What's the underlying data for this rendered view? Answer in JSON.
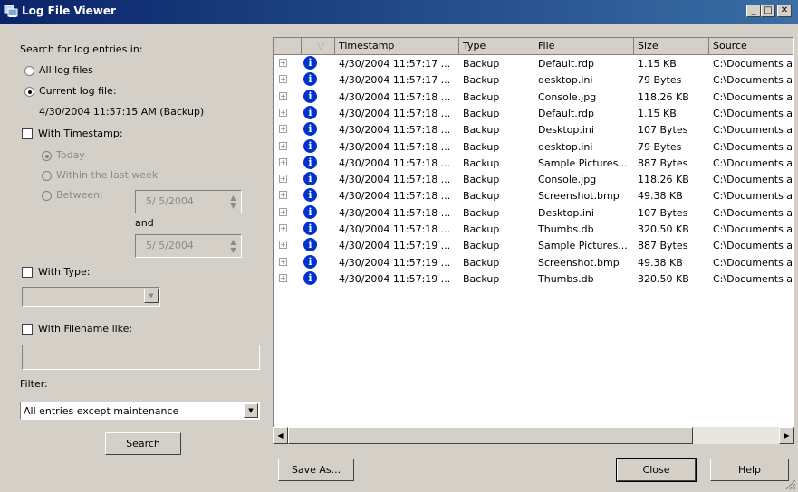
{
  "window": {
    "title": "Log File Viewer",
    "minimize_glyph": "_",
    "maximize_glyph": "□",
    "close_glyph": "✕"
  },
  "search": {
    "heading": "Search for log entries in:",
    "all_log_files": "All log files",
    "current_log_file": "Current log file:",
    "current_log_value": "4/30/2004 11:57:15 AM (Backup)",
    "selected_scope": "current_log_file"
  },
  "timestamp": {
    "label": "With Timestamp:",
    "checked": false,
    "today": "Today",
    "within_last_week": "Within the last week",
    "between": "Between:",
    "and": "and",
    "from_date": "5/  5/2004",
    "to_date": "5/  5/2004"
  },
  "type": {
    "label": "With Type:",
    "checked": false,
    "value": ""
  },
  "filename": {
    "label": "With Filename like:",
    "checked": false,
    "value": ""
  },
  "filter": {
    "label": "Filter:",
    "value": "All entries except maintenance"
  },
  "buttons": {
    "search": "Search",
    "save_as": "Save As...",
    "close": "Close",
    "help": "Help"
  },
  "table": {
    "columns": [
      "",
      "",
      "Timestamp",
      "Type",
      "File",
      "Size",
      "Source"
    ],
    "rows": [
      {
        "timestamp": "4/30/2004 11:57:17 ...",
        "type": "Backup",
        "file": "Default.rdp",
        "size": "1.15 KB",
        "source": "C:\\Documents an"
      },
      {
        "timestamp": "4/30/2004 11:57:17 ...",
        "type": "Backup",
        "file": "desktop.ini",
        "size": "79 Bytes",
        "source": "C:\\Documents an"
      },
      {
        "timestamp": "4/30/2004 11:57:18 ...",
        "type": "Backup",
        "file": "Console.jpg",
        "size": "118.26 KB",
        "source": "C:\\Documents an"
      },
      {
        "timestamp": "4/30/2004 11:57:18 ...",
        "type": "Backup",
        "file": "Default.rdp",
        "size": "1.15 KB",
        "source": "C:\\Documents an"
      },
      {
        "timestamp": "4/30/2004 11:57:18 ...",
        "type": "Backup",
        "file": "Desktop.ini",
        "size": "107 Bytes",
        "source": "C:\\Documents an"
      },
      {
        "timestamp": "4/30/2004 11:57:18 ...",
        "type": "Backup",
        "file": "desktop.ini",
        "size": "79 Bytes",
        "source": "C:\\Documents an"
      },
      {
        "timestamp": "4/30/2004 11:57:18 ...",
        "type": "Backup",
        "file": "Sample Pictures...",
        "size": "887 Bytes",
        "source": "C:\\Documents an"
      },
      {
        "timestamp": "4/30/2004 11:57:18 ...",
        "type": "Backup",
        "file": "Console.jpg",
        "size": "118.26 KB",
        "source": "C:\\Documents an"
      },
      {
        "timestamp": "4/30/2004 11:57:18 ...",
        "type": "Backup",
        "file": "Screenshot.bmp",
        "size": "49.38 KB",
        "source": "C:\\Documents an"
      },
      {
        "timestamp": "4/30/2004 11:57:18 ...",
        "type": "Backup",
        "file": "Desktop.ini",
        "size": "107 Bytes",
        "source": "C:\\Documents an"
      },
      {
        "timestamp": "4/30/2004 11:57:18 ...",
        "type": "Backup",
        "file": "Thumbs.db",
        "size": "320.50 KB",
        "source": "C:\\Documents an"
      },
      {
        "timestamp": "4/30/2004 11:57:19 ...",
        "type": "Backup",
        "file": "Sample Pictures...",
        "size": "887 Bytes",
        "source": "C:\\Documents an"
      },
      {
        "timestamp": "4/30/2004 11:57:19 ...",
        "type": "Backup",
        "file": "Screenshot.bmp",
        "size": "49.38 KB",
        "source": "C:\\Documents an"
      },
      {
        "timestamp": "4/30/2004 11:57:19 ...",
        "type": "Backup",
        "file": "Thumbs.db",
        "size": "320.50 KB",
        "source": "C:\\Documents an"
      }
    ],
    "expander_glyph": "+",
    "info_glyph": "i",
    "row_icon": "info-icon"
  },
  "colors": {
    "titlebar_start": "#0a246a",
    "titlebar_end": "#3a6ea5",
    "window_bg": "#d4d0c8",
    "info_icon": "#0033cc"
  }
}
